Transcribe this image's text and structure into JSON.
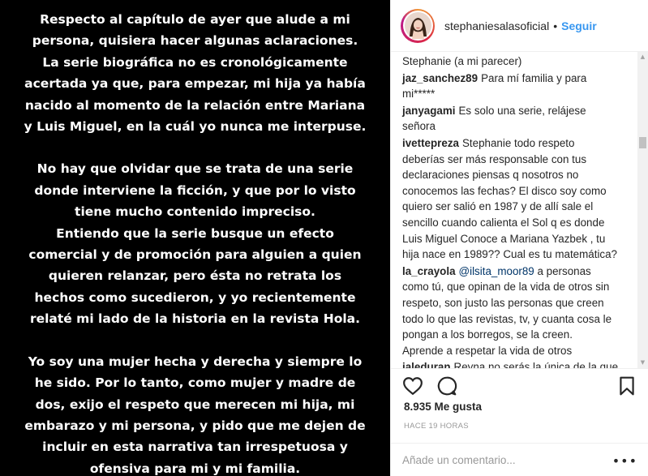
{
  "story": {
    "paragraphs": [
      [
        "Respecto al capítulo de ayer que alude a mi",
        "persona, quisiera hacer algunas aclaraciones.",
        "La serie biográfica no es cronológicamente",
        "acertada ya que, para empezar, mi hija ya había",
        "nacido al momento de la relación entre Mariana",
        "y Luis Miguel, en la cuál yo nunca me interpuse."
      ],
      [
        "No hay que olvidar que se trata de una serie",
        "donde interviene la ficción, y que por lo visto",
        "tiene mucho contenido impreciso.",
        "Entiendo que la serie busque un efecto",
        "comercial y de promoción para alguien a quien",
        "quieren relanzar, pero ésta no retrata los",
        "hechos como sucedieron, y yo recientemente",
        "relaté mi lado de la historia en la revista Hola."
      ],
      [
        "Yo soy una mujer hecha y derecha y siempre lo",
        "he sido. Por lo tanto, como mujer y madre de",
        "dos, exijo el respeto que merecen mi hija, mi",
        "embarazo y mi persona, y pido que me dejen de",
        "incluir en esta narrativa tan irrespetuosa y",
        "ofensiva para mi y mi familia."
      ]
    ]
  },
  "header": {
    "username": "stephaniesalasoficial",
    "separator": "•",
    "follow_label": "Seguir"
  },
  "comments": [
    {
      "user": "",
      "lines": [
        "Stephanie (a mi parecer)"
      ]
    },
    {
      "user": "jaz_sanchez89",
      "lines": [
        "Para mí familia y para",
        "mi*****"
      ]
    },
    {
      "user": "janyagami",
      "lines": [
        "Es solo una serie, relájese",
        "señora"
      ]
    },
    {
      "user": "ivettepreza",
      "lines": [
        "Stephanie todo respeto",
        "deberías ser más responsable con tus",
        "declaraciones piensas q nosotros no",
        "conocemos las fechas? El disco soy como",
        "quiero ser salió en 1987 y de allí sale el",
        "sencillo cuando calienta el Sol q es donde",
        "Luis Miguel Conoce a Mariana Yazbek , tu",
        "hija nace en 1989?? Cual es tu matemática?"
      ]
    },
    {
      "user": "la_crayola",
      "mention": "@ilsita_moor89",
      "lines": [
        "a personas",
        "como tú, que opinan de la vida de otros sin",
        "respeto, son justo las personas que creen",
        "todo lo que las revistas, tv, y cuanta cosa le",
        "pongan a los borregos, se la creen.",
        "Aprende a respetar la vida de otros"
      ]
    },
    {
      "user": "ialeduran",
      "lines": [
        "Reyna no serás la única de la que"
      ]
    }
  ],
  "actions": {
    "like_icon": "heart-outline-icon",
    "comment_icon": "speech-bubble-icon",
    "save_icon": "bookmark-icon"
  },
  "likes_text": "8.935 Me gusta",
  "time_text": "HACE 19 HORAS",
  "add_comment_placeholder": "Añade un comentario...",
  "more_label": "•••",
  "colors": {
    "link_blue": "#3897f0",
    "text": "#262626",
    "muted": "#999999",
    "border": "#efefef"
  }
}
